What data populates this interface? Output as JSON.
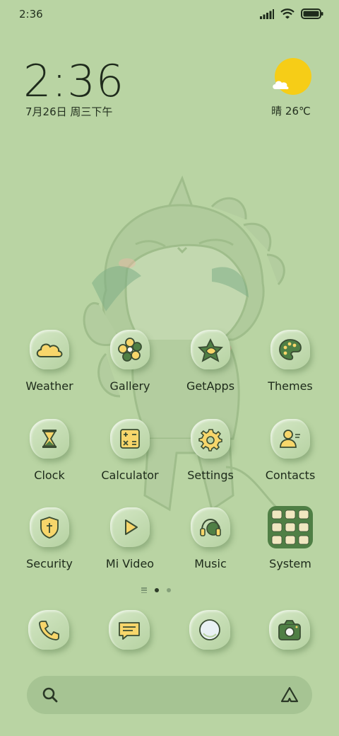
{
  "status_bar": {
    "time": "2:36",
    "icons": [
      "signal-icon",
      "wifi-icon",
      "battery-icon"
    ]
  },
  "clock_widget": {
    "time": "2:36",
    "date": "7月26日 周三下午"
  },
  "weather_widget": {
    "condition": "晴",
    "temperature": "26℃",
    "icon": "sun-cloud-icon"
  },
  "apps": [
    {
      "label": "Weather",
      "icon": "cloud-icon"
    },
    {
      "label": "Gallery",
      "icon": "flower-icon"
    },
    {
      "label": "GetApps",
      "icon": "star-leaf-icon"
    },
    {
      "label": "Themes",
      "icon": "palette-icon"
    },
    {
      "label": "Clock",
      "icon": "hourglass-icon"
    },
    {
      "label": "Calculator",
      "icon": "calculator-icon"
    },
    {
      "label": "Settings",
      "icon": "gear-icon"
    },
    {
      "label": "Contacts",
      "icon": "person-icon"
    },
    {
      "label": "Security",
      "icon": "shield-icon"
    },
    {
      "label": "Mi Video",
      "icon": "play-icon"
    },
    {
      "label": "Music",
      "icon": "headphones-icon"
    },
    {
      "label": "System",
      "icon": "app-folder-icon"
    }
  ],
  "pager": {
    "pages": 2,
    "current": 1
  },
  "dock": [
    {
      "name": "phone",
      "icon": "phone-icon"
    },
    {
      "name": "messages",
      "icon": "message-icon"
    },
    {
      "name": "browser",
      "icon": "browser-icon"
    },
    {
      "name": "camera",
      "icon": "camera-icon"
    }
  ],
  "search_bar": {
    "icon": "search-icon",
    "assistant_icon": "assistant-icon"
  },
  "colors": {
    "background": "#b9d4a3",
    "accent_yellow": "#f7d66b",
    "accent_green": "#4f7f45",
    "outline": "#3a4d33"
  }
}
